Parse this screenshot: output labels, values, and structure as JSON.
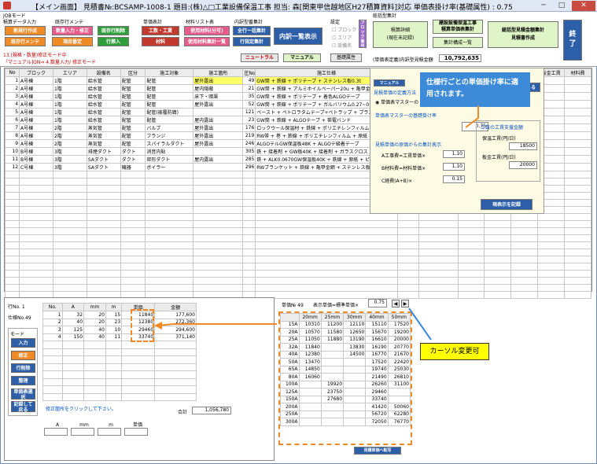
{
  "window": {
    "title": "【メイン画面】 見積書№:BCSAMP-1008-1  題目:(株)△□工業設備保温工事  担当:      森[関東甲信越地区H27積算資料]対応    単価表掛け率(基礎属性) : 0.75",
    "minimize": "─",
    "maximize": "□",
    "close": "✕"
  },
  "toolbar": {
    "group_job_mode": "JOBモード",
    "group_job_data_input": "積算データ入力",
    "group_existing_menu": "既存行メンテ",
    "btn_new_row": "新規行作成",
    "btn_qty_input_edit": "数量入力・修正",
    "btn_existing_delete": "既存行削除",
    "btn_existing_row_menu": "既存行メンテ",
    "btn_item_register": "項目番定",
    "btn_row_insert": "行挿入",
    "group_unit_price": "単価表計",
    "btn_labor_cost": "工数・工賃",
    "btn_material": "材料",
    "group_material_list": "材料リスト表",
    "btn_used_material_list": "使用材料(分可)",
    "btn_used_material_total": "使用材料集計一覧",
    "group_internal_breakdown": "内訳型番集計",
    "btn_whole_row_total": "全行一括集計",
    "btn_row_designation_total": "行指定集計",
    "btn_breakdown_list": "内訳一覧表示",
    "group_settings": "設定",
    "chk_block": "ブロック",
    "chk_area": "エリア",
    "chk_system": "設備名",
    "btn_blue_label": "ブロック番号",
    "btn_neutral": "ニュートラル",
    "btn_manual": "マニュアル",
    "btn_basic_attributes": "基礎属性",
    "group_total_results": "総括型集計",
    "btn_estimate_detail": "積算詳細\n(現在未記録)",
    "btn_const_total": "建設設備保温工事\n積算単価表集計",
    "btn_estimate_total": "総括型見積金額集計\n見積書作成",
    "btn_calc_structure": "集計構成一覧",
    "btn_end": "終\n了",
    "total_label": "(単価表定義)内訳型見積金額",
    "total_value": "10,792,635",
    "mode_note_1": "13.(規格・数量)修正モード中",
    "mode_note_2": "「マニュアル]ON⇒ 4.数量入力/ 修正モード"
  },
  "main_table": {
    "headers": [
      "No",
      "ブロック",
      "エリア",
      "設備名",
      "区分",
      "施工対象",
      "施工箇所",
      "圧No",
      "施工仕様",
      "単価%",
      "金額",
      "工数",
      "工賃",
      "板金工数",
      "板金工賃",
      "材料費"
    ],
    "rows": [
      {
        "no": "1",
        "block": "A号棟",
        "area": "1階",
        "equip": "給水管",
        "kubun": "配管",
        "target": "配管",
        "place": "屋外露出",
        "pno": "49",
        "spec": "GW筒 + 鉄線 + ポリテープ + ステンレス板0.3t"
      },
      {
        "no": "2",
        "block": "A号棟",
        "area": "1階",
        "equip": "給水管",
        "kubun": "配管",
        "target": "配管",
        "place": "屋内隠蔽",
        "pno": "21",
        "spec": "GW筒 + 鉄線 + アルミホイルペーパー20u + 亀甲金網0.5t"
      },
      {
        "no": "3",
        "block": "A号棟",
        "area": "1階",
        "equip": "給水管",
        "kubun": "配管",
        "target": "配管",
        "place": "床下・暗渠",
        "pno": "35",
        "spec": "GW筒 + 鉄線 + ポリテープ + 着色ALGOテープ"
      },
      {
        "no": "4",
        "block": "A号棟",
        "area": "1階",
        "equip": "給水管",
        "kubun": "配管",
        "target": "配管",
        "place": "屋外露出",
        "pno": "52",
        "spec": "GW筒 + 鉄線 + ポリテープ + ガルバリウム0.27~0.35t"
      },
      {
        "no": "5",
        "block": "A号棟",
        "area": "1階",
        "equip": "給水管",
        "kubun": "配管",
        "target": "配管(被覆防錆)",
        "place": "",
        "pno": "121",
        "spec": "ペースト + ペトロラタムテープ+ペトラップ + プラスチックテープ"
      },
      {
        "no": "6",
        "block": "A号棟",
        "area": "1階",
        "equip": "給水管",
        "kubun": "配管",
        "target": "配管",
        "place": "屋内露出",
        "pno": "23",
        "spec": "GW筒 + 鉄線 + ALGOテープ + 帯電バンド"
      },
      {
        "no": "7",
        "block": "A号棟",
        "area": "2階",
        "equip": "蒸気管",
        "kubun": "配管",
        "target": "バルブ",
        "place": "屋外露出",
        "pno": "176",
        "spec": "ロックウール保温材 + 鉄線 + ポリエチレンフィルム + アルミ板0.8t"
      },
      {
        "no": "8",
        "block": "A号棟",
        "area": "2階",
        "equip": "蒸気管",
        "kubun": "配管",
        "target": "フランジ",
        "place": "屋外露出",
        "pno": "219",
        "spec": "RW帯 + 巻 + 鉄線 + ポリエチレンフィルム + 原紙 + アルミ板"
      },
      {
        "no": "9",
        "block": "A号棟",
        "area": "2階",
        "equip": "蒸気管",
        "kubun": "配管",
        "target": "スパイラルダクト",
        "place": "屋外露出",
        "pno": "246",
        "spec": "ALGOテルGW保温板48K + ALGOテ級着テープ"
      },
      {
        "no": "10",
        "block": "B号棟",
        "area": "3階",
        "equip": "排煙ダクト",
        "kubun": "ダクト",
        "target": "消音内貼",
        "place": "",
        "pno": "305",
        "spec": "鉄 + 接着剤 + GW板40K + 接着剤 + ガラスクロス + ピン"
      },
      {
        "no": "11",
        "block": "B号棟",
        "area": "3階",
        "equip": "SAダクト",
        "kubun": "ダクト",
        "target": "矩形ダクト",
        "place": "屋内露出",
        "pno": "285",
        "spec": "鉄 + ALK0.0670GW保温板40K + 鉄線 + 原紙 + ピン"
      },
      {
        "no": "12",
        "block": "C号棟",
        "area": "3階",
        "equip": "SAダクト",
        "kubun": "機器",
        "target": "ボイラー",
        "place": "",
        "pno": "296",
        "spec": "RWブランケット + 鉄線 + 亀甲金網 + ステンレス板0.3t"
      }
    ],
    "first_row_unit": "0.75",
    "first_row_amount": "1,056,780"
  },
  "popup": {
    "manual_btn": "マニュアル",
    "section_label": "見積単価の定義方法",
    "radio_master": "単価表マスターの",
    "master_rate_label": "単価表マスターの基礎掛け率",
    "master_rate": "0.75",
    "calc_label": "見積単価の原価からの集計表示",
    "a_label": "A工事費=工賃単価×",
    "a_value": "1.10",
    "b_label": "B材料費=材料単価×",
    "b_value": "1.10",
    "c_label": "C経費(A+B)×",
    "c_value": "0.15",
    "labor_title": "工数の工賃支援金額",
    "labor_fee_label": "保温工賃(円/日)",
    "labor_fee": "18500",
    "sheet_fee_label": "板金工賃(円/日)",
    "sheet_fee": "20000",
    "save_btn": "現表示を記録",
    "close_btn": "閉じる"
  },
  "callout_top": "仕様行ごとの単価掛け率に適用されます。",
  "callout_bottom": "カーソル変更可",
  "bottom": {
    "row_no_label": "行No. 1",
    "spec_label": "仕様No.49",
    "mode_label": "モード",
    "mode_btns": [
      "入力",
      "修正",
      "行削除",
      "整理",
      "単価表選択",
      "記録して戻る"
    ],
    "qty_headers": [
      "No.",
      "A",
      "mm",
      "m",
      "単価",
      "金額"
    ],
    "qty_rows": [
      {
        "no": "1",
        "a": "32",
        "mm": "20",
        "m": "15",
        "price": "11840",
        "amount": "177,600"
      },
      {
        "no": "2",
        "a": "40",
        "mm": "20",
        "m": "23",
        "price": "12380",
        "amount": "272,360"
      },
      {
        "no": "3",
        "a": "125",
        "a2": "40",
        "m": "10",
        "price": "29460",
        "amount": "294,600"
      },
      {
        "no": "4",
        "a": "150",
        "mm": "40",
        "m": "11",
        "price": "33740",
        "amount": "371,140"
      }
    ],
    "total_label": "合計",
    "total_value": "1,056,780",
    "hint": "修正箇所をクリックして下さい。",
    "input_headers": [
      "A",
      "mm",
      "m",
      "単価"
    ]
  },
  "unit_table": {
    "spec_label": "単価№ 49",
    "rate_label": "表示単価=標準単価×",
    "rate_value": "0.75",
    "headers": [
      "",
      "20mm",
      "25mm",
      "30mm",
      "40mm",
      "50mm"
    ],
    "rows": [
      [
        "15A",
        "10310",
        "11200",
        "12110",
        "15110",
        "17520"
      ],
      [
        "20A",
        "10570",
        "11580",
        "12650",
        "15670",
        "19200"
      ],
      [
        "25A",
        "11050",
        "11880",
        "13190",
        "16610",
        "20000"
      ],
      [
        "32A",
        "11840",
        "",
        "13830",
        "16190",
        "20770"
      ],
      [
        "40A",
        "12380",
        "",
        "14500",
        "16770",
        "21670"
      ],
      [
        "50A",
        "13470",
        "",
        "",
        "17520",
        "22420"
      ],
      [
        "65A",
        "14850",
        "",
        "",
        "19740",
        "25030"
      ],
      [
        "80A",
        "16060",
        "",
        "",
        "21490",
        "26810"
      ],
      [
        "100A",
        "",
        "19920",
        "",
        "26260",
        "31100"
      ],
      [
        "125A",
        "",
        "23750",
        "",
        "29460",
        ""
      ],
      [
        "150A",
        "",
        "27680",
        "",
        "33740",
        ""
      ],
      [
        "200A",
        "",
        "",
        "",
        "41420",
        "50060"
      ],
      [
        "250A",
        "",
        "",
        "",
        "56720",
        "62280"
      ],
      [
        "300A",
        "",
        "",
        "",
        "72050",
        "76770"
      ]
    ],
    "footer_btn": "見積単価へ転写"
  }
}
